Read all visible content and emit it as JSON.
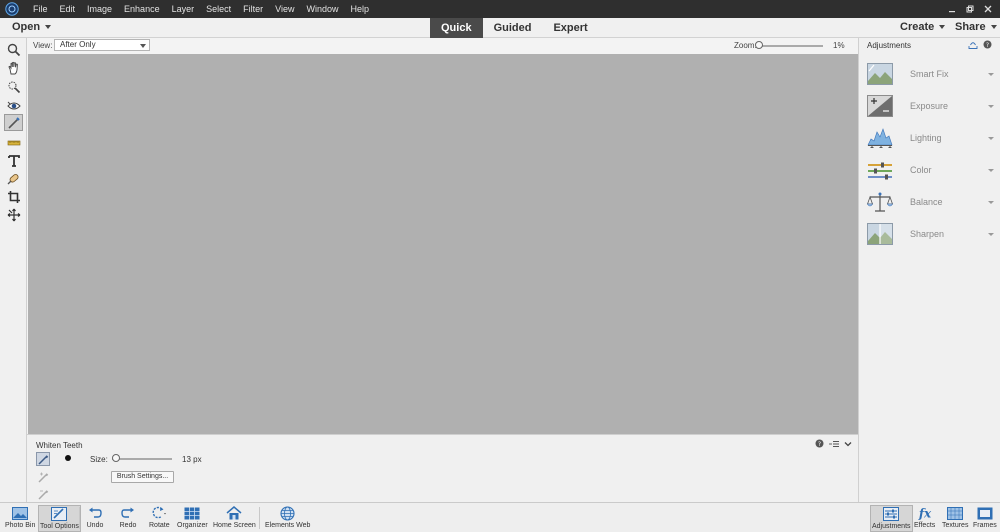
{
  "menubar": {
    "items": [
      "File",
      "Edit",
      "Image",
      "Enhance",
      "Layer",
      "Select",
      "Filter",
      "View",
      "Window",
      "Help"
    ]
  },
  "topbar": {
    "open_label": "Open",
    "modes": [
      "Quick",
      "Guided",
      "Expert"
    ],
    "active_mode": "Quick",
    "create_label": "Create",
    "share_label": "Share"
  },
  "viewbar": {
    "view_label": "View:",
    "view_value": "After Only",
    "zoom_label": "Zoom:",
    "zoom_value": "1%"
  },
  "tools": [
    "zoom-tool-icon",
    "hand-tool-icon",
    "quick-selection-icon",
    "red-eye-icon",
    "whiten-teeth-icon",
    "straighten-icon",
    "type-tool-icon",
    "spot-healing-icon",
    "crop-icon",
    "move-icon"
  ],
  "tool_options": {
    "title": "Whiten Teeth",
    "size_label": "Size:",
    "size_value": "13 px",
    "brush_settings_label": "Brush Settings..."
  },
  "adjustments": {
    "title": "Adjustments",
    "items": [
      {
        "label": "Smart Fix",
        "icon": "smart-fix-icon"
      },
      {
        "label": "Exposure",
        "icon": "exposure-icon"
      },
      {
        "label": "Lighting",
        "icon": "lighting-icon"
      },
      {
        "label": "Color",
        "icon": "color-icon"
      },
      {
        "label": "Balance",
        "icon": "balance-icon"
      },
      {
        "label": "Sharpen",
        "icon": "sharpen-icon"
      }
    ]
  },
  "dock": {
    "left": [
      "Photo Bin",
      "Tool Options",
      "Undo",
      "Redo",
      "Rotate",
      "Organizer",
      "Home Screen",
      "Elements Web"
    ],
    "right": [
      "Adjustments",
      "Effects",
      "Textures",
      "Frames"
    ]
  },
  "colors": {
    "menubar_bg": "#2f2f2f",
    "active_tab_bg": "#4a4a4a",
    "canvas_bg": "#b0b0b0",
    "accent": "#2f6fb4"
  }
}
